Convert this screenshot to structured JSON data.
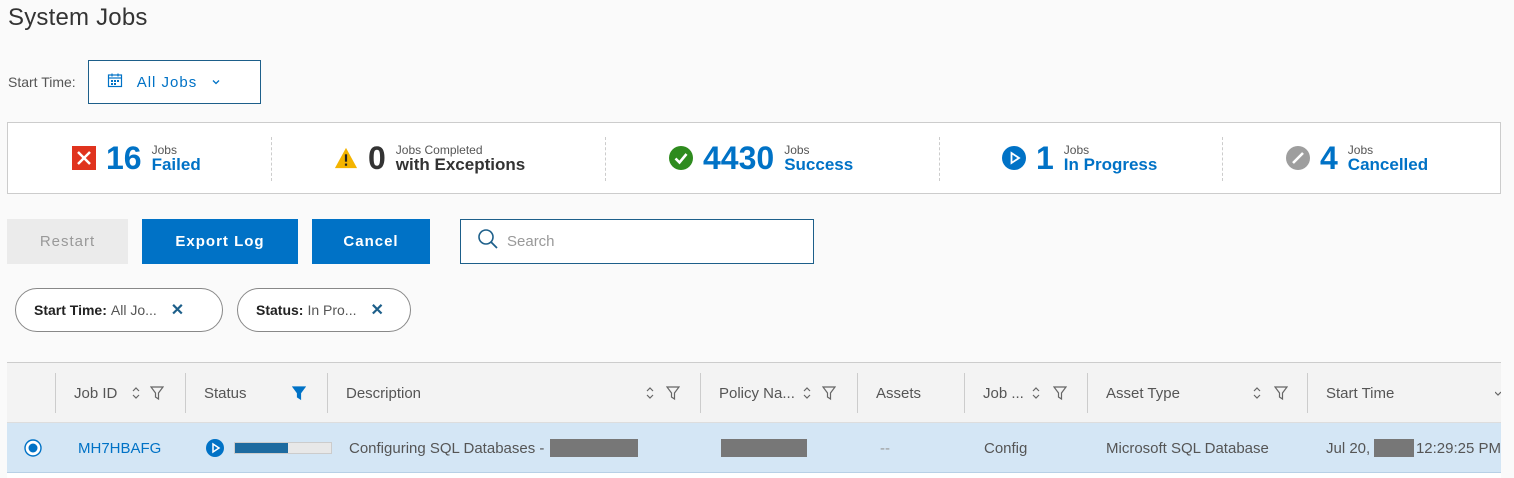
{
  "page": {
    "title": "System Jobs"
  },
  "filter": {
    "start_time_label": "Start Time:",
    "dropdown_value": "All Jobs"
  },
  "summary": [
    {
      "count": "16",
      "small": "Jobs",
      "big": "Failed",
      "status": "failed",
      "color": "#e0331e"
    },
    {
      "count": "0",
      "small": "Jobs Completed",
      "big": "with Exceptions",
      "status": "exceptions",
      "color": "#f4b400"
    },
    {
      "count": "4430",
      "small": "Jobs",
      "big": "Success",
      "status": "success",
      "color": "#2e8b1e"
    },
    {
      "count": "1",
      "small": "Jobs",
      "big": "In Progress",
      "status": "in-progress",
      "color": "#0072c6"
    },
    {
      "count": "4",
      "small": "Jobs",
      "big": "Cancelled",
      "status": "cancelled",
      "color": "#9e9e9e"
    }
  ],
  "actions": {
    "restart": "Restart",
    "export_log": "Export Log",
    "cancel": "Cancel"
  },
  "search": {
    "placeholder": "Search"
  },
  "chips": [
    {
      "key": "Start Time:",
      "value": "All Jo..."
    },
    {
      "key": "Status:",
      "value": "In Pro..."
    }
  ],
  "table": {
    "columns": [
      "Job ID",
      "Status",
      "Description",
      "Policy Na...",
      "Assets",
      "Job ...",
      "Asset Type",
      "Start Time"
    ],
    "rows": [
      {
        "job_id": "MH7HBAFG",
        "progress": 0.55,
        "description": "Configuring SQL Databases -",
        "assets": "--",
        "job_type": "Config",
        "asset_type": "Microsoft SQL Database",
        "start_time_prefix": "Jul 20,",
        "start_time_suffix": "12:29:25 PM"
      }
    ]
  },
  "colors": {
    "accent": "#0072c6",
    "row_selected": "#d4e6f5"
  }
}
